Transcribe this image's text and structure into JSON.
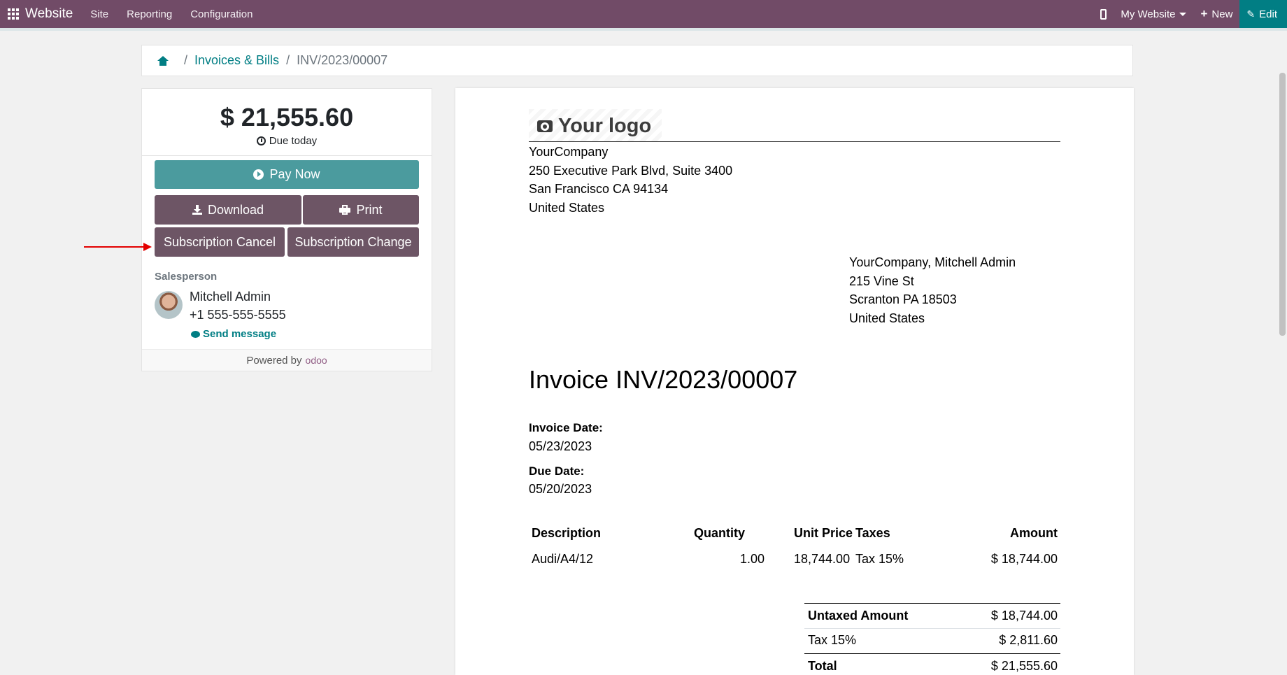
{
  "navbar": {
    "brand": "Website",
    "menus": [
      "Site",
      "Reporting",
      "Configuration"
    ],
    "website_selector": "My Website",
    "new_label": "New",
    "edit_label": "Edit"
  },
  "breadcrumb": {
    "link": "Invoices & Bills",
    "current": "INV/2023/00007"
  },
  "sidebar": {
    "amount": "$ 21,555.60",
    "due_label": "Due today",
    "pay_now": "Pay Now",
    "download": "Download",
    "print": "Print",
    "subscription_cancel": "Subscription Cancel",
    "subscription_change": "Subscription Change",
    "salesperson_label": "Salesperson",
    "salesperson_name": "Mitchell Admin",
    "salesperson_phone": "+1 555-555-5555",
    "send_message": "Send message",
    "powered_by": "Powered by",
    "odoo": "odoo"
  },
  "invoice": {
    "logo_text": "Your logo",
    "company_address": [
      "YourCompany",
      "250 Executive Park Blvd, Suite 3400",
      "San Francisco CA 94134",
      "United States"
    ],
    "customer_address": [
      "YourCompany, Mitchell Admin",
      "215 Vine St",
      "Scranton PA 18503",
      "United States"
    ],
    "title": "Invoice INV/2023/00007",
    "invoice_date_label": "Invoice Date:",
    "invoice_date": "05/23/2023",
    "due_date_label": "Due Date:",
    "due_date": "05/20/2023",
    "columns": {
      "description": "Description",
      "quantity": "Quantity",
      "unit_price": "Unit Price",
      "taxes": "Taxes",
      "amount": "Amount"
    },
    "lines": [
      {
        "description": "Audi/A4/12",
        "quantity": "1.00",
        "unit_price": "18,744.00",
        "taxes": "Tax 15%",
        "amount": "$ 18,744.00"
      }
    ],
    "totals": {
      "untaxed_label": "Untaxed Amount",
      "untaxed_value": "$ 18,744.00",
      "tax_label": "Tax 15%",
      "tax_value": "$ 2,811.60",
      "total_label": "Total",
      "total_value": "$ 21,555.60"
    }
  }
}
